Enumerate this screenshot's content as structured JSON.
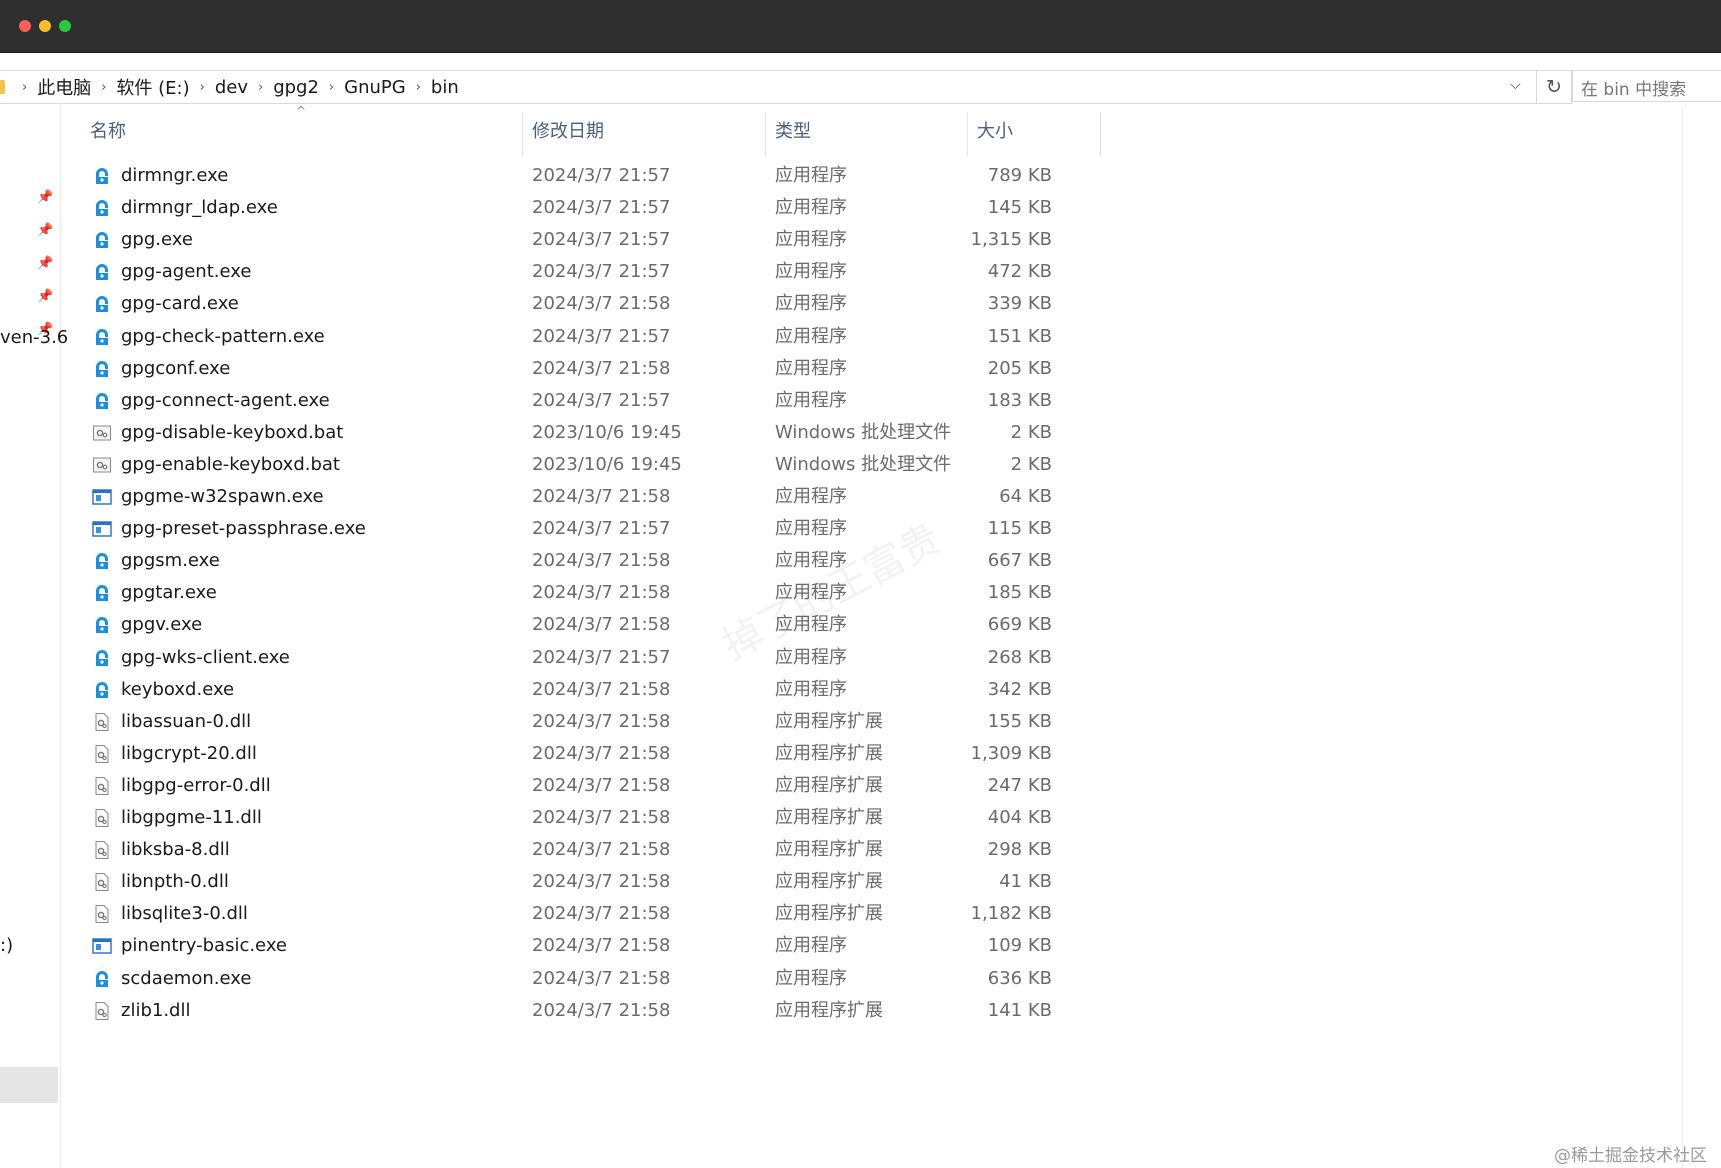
{
  "breadcrumb": [
    "此电脑",
    "软件 (E:)",
    "dev",
    "gpg2",
    "GnuPG",
    "bin"
  ],
  "search": {
    "placeholder": "在 bin 中搜索"
  },
  "navpane": {
    "fragment_1": "ven-3.6",
    "fragment_2": ":)"
  },
  "columns": {
    "name": "名称",
    "date": "修改日期",
    "type": "类型",
    "size": "大小"
  },
  "files": [
    {
      "name": "dirmngr.exe",
      "date": "2024/3/7 21:57",
      "type": "应用程序",
      "size": "789 KB",
      "icon": "gnupg-app-icon"
    },
    {
      "name": "dirmngr_ldap.exe",
      "date": "2024/3/7 21:57",
      "type": "应用程序",
      "size": "145 KB",
      "icon": "gnupg-app-icon"
    },
    {
      "name": "gpg.exe",
      "date": "2024/3/7 21:57",
      "type": "应用程序",
      "size": "1,315 KB",
      "icon": "gnupg-app-icon"
    },
    {
      "name": "gpg-agent.exe",
      "date": "2024/3/7 21:57",
      "type": "应用程序",
      "size": "472 KB",
      "icon": "gnupg-app-icon"
    },
    {
      "name": "gpg-card.exe",
      "date": "2024/3/7 21:58",
      "type": "应用程序",
      "size": "339 KB",
      "icon": "gnupg-app-icon"
    },
    {
      "name": "gpg-check-pattern.exe",
      "date": "2024/3/7 21:57",
      "type": "应用程序",
      "size": "151 KB",
      "icon": "gnupg-app-icon"
    },
    {
      "name": "gpgconf.exe",
      "date": "2024/3/7 21:58",
      "type": "应用程序",
      "size": "205 KB",
      "icon": "gnupg-app-icon"
    },
    {
      "name": "gpg-connect-agent.exe",
      "date": "2024/3/7 21:57",
      "type": "应用程序",
      "size": "183 KB",
      "icon": "gnupg-app-icon"
    },
    {
      "name": "gpg-disable-keyboxd.bat",
      "date": "2023/10/6 19:45",
      "type": "Windows 批处理文件",
      "size": "2 KB",
      "icon": "batch-file-icon"
    },
    {
      "name": "gpg-enable-keyboxd.bat",
      "date": "2023/10/6 19:45",
      "type": "Windows 批处理文件",
      "size": "2 KB",
      "icon": "batch-file-icon"
    },
    {
      "name": "gpgme-w32spawn.exe",
      "date": "2024/3/7 21:58",
      "type": "应用程序",
      "size": "64 KB",
      "icon": "window-app-icon"
    },
    {
      "name": "gpg-preset-passphrase.exe",
      "date": "2024/3/7 21:57",
      "type": "应用程序",
      "size": "115 KB",
      "icon": "window-app-icon"
    },
    {
      "name": "gpgsm.exe",
      "date": "2024/3/7 21:58",
      "type": "应用程序",
      "size": "667 KB",
      "icon": "gnupg-app-icon"
    },
    {
      "name": "gpgtar.exe",
      "date": "2024/3/7 21:58",
      "type": "应用程序",
      "size": "185 KB",
      "icon": "gnupg-app-icon"
    },
    {
      "name": "gpgv.exe",
      "date": "2024/3/7 21:58",
      "type": "应用程序",
      "size": "669 KB",
      "icon": "gnupg-app-icon"
    },
    {
      "name": "gpg-wks-client.exe",
      "date": "2024/3/7 21:57",
      "type": "应用程序",
      "size": "268 KB",
      "icon": "gnupg-app-icon"
    },
    {
      "name": "keyboxd.exe",
      "date": "2024/3/7 21:58",
      "type": "应用程序",
      "size": "342 KB",
      "icon": "gnupg-app-icon"
    },
    {
      "name": "libassuan-0.dll",
      "date": "2024/3/7 21:58",
      "type": "应用程序扩展",
      "size": "155 KB",
      "icon": "dll-file-icon"
    },
    {
      "name": "libgcrypt-20.dll",
      "date": "2024/3/7 21:58",
      "type": "应用程序扩展",
      "size": "1,309 KB",
      "icon": "dll-file-icon"
    },
    {
      "name": "libgpg-error-0.dll",
      "date": "2024/3/7 21:58",
      "type": "应用程序扩展",
      "size": "247 KB",
      "icon": "dll-file-icon"
    },
    {
      "name": "libgpgme-11.dll",
      "date": "2024/3/7 21:58",
      "type": "应用程序扩展",
      "size": "404 KB",
      "icon": "dll-file-icon"
    },
    {
      "name": "libksba-8.dll",
      "date": "2024/3/7 21:58",
      "type": "应用程序扩展",
      "size": "298 KB",
      "icon": "dll-file-icon"
    },
    {
      "name": "libnpth-0.dll",
      "date": "2024/3/7 21:58",
      "type": "应用程序扩展",
      "size": "41 KB",
      "icon": "dll-file-icon"
    },
    {
      "name": "libsqlite3-0.dll",
      "date": "2024/3/7 21:58",
      "type": "应用程序扩展",
      "size": "1,182 KB",
      "icon": "dll-file-icon"
    },
    {
      "name": "pinentry-basic.exe",
      "date": "2024/3/7 21:58",
      "type": "应用程序",
      "size": "109 KB",
      "icon": "window-app-icon"
    },
    {
      "name": "scdaemon.exe",
      "date": "2024/3/7 21:58",
      "type": "应用程序",
      "size": "636 KB",
      "icon": "gnupg-app-icon"
    },
    {
      "name": "zlib1.dll",
      "date": "2024/3/7 21:58",
      "type": "应用程序扩展",
      "size": "141 KB",
      "icon": "dll-file-icon"
    }
  ],
  "watermark": "掉了的王富贵",
  "footer_watermark": "@稀土掘金技术社区"
}
